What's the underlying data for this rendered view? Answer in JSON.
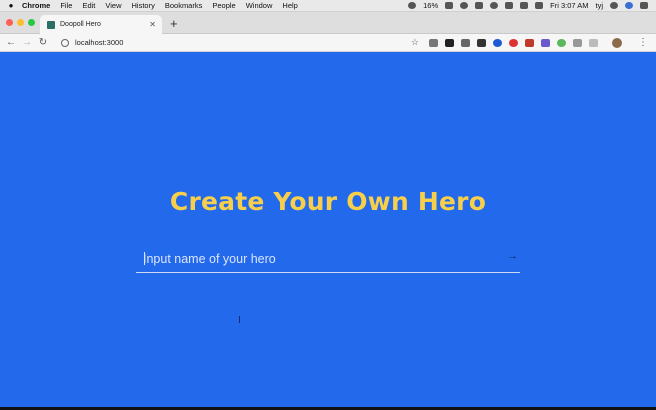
{
  "menubar": {
    "app_name": "Chrome",
    "items": [
      "File",
      "Edit",
      "View",
      "History",
      "Bookmarks",
      "People",
      "Window",
      "Help"
    ],
    "battery": "16%",
    "clock": "Fri 3:07 AM",
    "user": "tyj"
  },
  "tab": {
    "title": "Doopoll Hero",
    "close_glyph": "✕"
  },
  "newtab_glyph": "+",
  "toolbar": {
    "back_glyph": "←",
    "forward_glyph": "→",
    "reload_glyph": "↻",
    "url": "localhost:3000",
    "star_glyph": "☆",
    "menu_glyph": "⋮"
  },
  "hero": {
    "title": "Create Your Own Hero",
    "input_placeholder": "Input name of your hero",
    "input_value": "",
    "submit_glyph": "→"
  },
  "colors": {
    "page_background": "#2369ec",
    "title_color": "#f8cf4a"
  }
}
